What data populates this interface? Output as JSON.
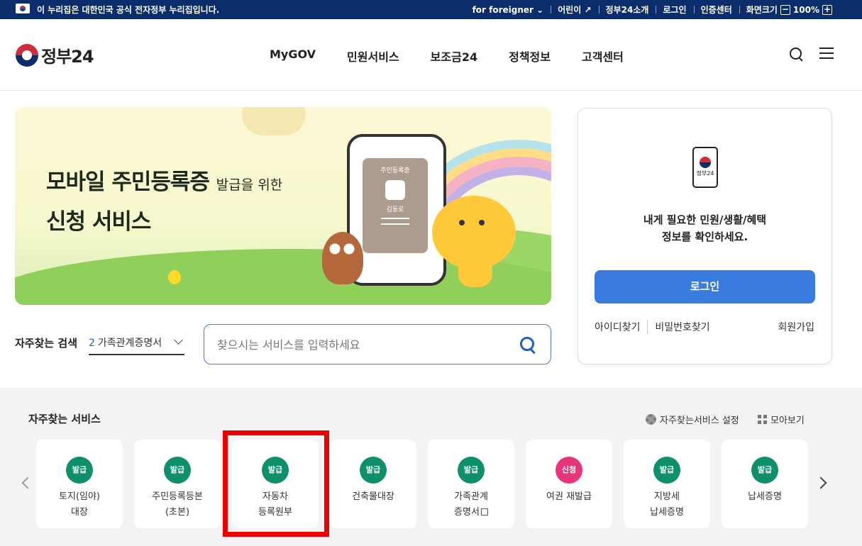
{
  "topbar": {
    "notice": "이 누리집은 대한민국 공식 전자정부 누리집입니다.",
    "links": [
      "for foreigner",
      "어린이",
      "정부24소개",
      "로그인",
      "인증센터"
    ],
    "font_size_label": "화면크기",
    "zoom": "100%",
    "zoom_minus": "−",
    "zoom_plus": "+"
  },
  "header": {
    "logo": "정부24",
    "nav": [
      "MyGOV",
      "민원서비스",
      "보조금24",
      "정책정보",
      "고객센터"
    ]
  },
  "banner": {
    "title_line1": "모바일 주민등록증",
    "title_suffix": "발급을 위한",
    "title_line2": "신청 서비스",
    "card_title": "주민등록증",
    "card_name": "김동로"
  },
  "search": {
    "fav_label": "자주찾는 검색",
    "fav_num": "2",
    "fav_value": "가족관계증명서",
    "placeholder": "찾으시는 서비스를 입력하세요"
  },
  "login": {
    "app_label": "정부24",
    "message_line1": "내게 필요한 민원/생활/혜택",
    "message_line2": "정보를 확인하세요.",
    "button": "로그인",
    "find_id": "아이디찾기",
    "find_pw": "비밀번호찾기",
    "signup": "회원가입"
  },
  "services": {
    "title": "자주찾는 서비스",
    "setting": "자주찾는서비스 설정",
    "view_all": "모아보기",
    "items": [
      {
        "badge": "발급",
        "label": "토지(임야)\n대장"
      },
      {
        "badge": "발급",
        "label": "주민등록등본\n(초본)"
      },
      {
        "badge": "발급",
        "label": "자동차\n등록원부"
      },
      {
        "badge": "발급",
        "label": "건축물대장"
      },
      {
        "badge": "발급",
        "label": "가족관계\n증명서"
      },
      {
        "badge": "신청",
        "label": "여권 재발급"
      },
      {
        "badge": "발급",
        "label": "지방세\n납세증명"
      },
      {
        "badge": "발급",
        "label": "납세증명"
      }
    ]
  },
  "colors": {
    "topbar": "#0b2d6b",
    "accent": "#3a7be0",
    "badge_green": "#0f8f6a",
    "badge_pink": "#e8347a",
    "highlight": "#ee0000"
  }
}
